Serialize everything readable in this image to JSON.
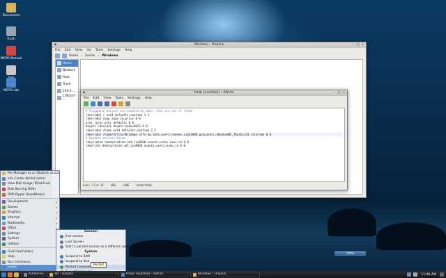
{
  "colors": {
    "accent": "#4a82c6",
    "highlight": "#5b8fd0",
    "taskbar": "#1c1f24"
  },
  "desktop": {
    "icons": [
      {
        "label": "Documents",
        "icon": "folder-icon",
        "color": "#d9b35a"
      },
      {
        "label": "Trash",
        "icon": "trash-icon",
        "color": "#9aa4ae"
      },
      {
        "label": "MEPIS Manual",
        "icon": "manual-icon",
        "color": "#d24a3f"
      },
      {
        "label": "Tiles",
        "icon": "tiles-icon",
        "color": "#c8c8c8"
      },
      {
        "label": "MEPIS site",
        "icon": "globe-icon",
        "color": "#4a86c9"
      }
    ]
  },
  "dolphin": {
    "title": "Windows – Dolphin",
    "menu": [
      "File",
      "Edit",
      "View",
      "Go",
      "Tools",
      "Settings",
      "Help"
    ],
    "breadcrumb": [
      "home",
      "Zerlas",
      "Windows"
    ],
    "places": [
      {
        "label": "Home",
        "selected": true
      },
      {
        "label": "Network",
        "selected": false
      },
      {
        "label": "Root",
        "selected": false
      },
      {
        "label": "Trash",
        "selected": false
      },
      {
        "label": "200.0 ...",
        "selected": false
      },
      {
        "label": "CTN/337 ...",
        "selected": false
      }
    ]
  },
  "kwrite": {
    "title": "fstab [modified] – KWrite",
    "menu": [
      "File",
      "Edit",
      "View",
      "Tools",
      "Settings",
      "Help"
    ],
    "lines": [
      {
        "text": "# Pluggable devices are handled by uDev, they are not in fstab",
        "kind": "comment"
      },
      {
        "text": "/dev/sdb2 / ext4 defaults,noatime 1 1",
        "kind": "entry"
      },
      {
        "text": "/dev/sdb3 swap swap sw,pri=1 0 0",
        "kind": "entry"
      },
      {
        "text": "proc /proc proc defaults 0 0",
        "kind": "entry"
      },
      {
        "text": "devpts /dev/pts devpts mode=0622 0 0",
        "kind": "entry"
      },
      {
        "text": "/dev/sdb3 /home ext4 defaults,noatime 1 2",
        "kind": "entry"
      },
      {
        "text": "/dev/sda1 /home/Zerlas/Windows ntfs-3g auto,users,noexec,uid=1000,gid=users,dmask=002,fmask=133,relatime 0 0",
        "kind": "entry",
        "current": true
      },
      {
        "text": "# Dynamic entries below",
        "kind": "comment"
      },
      {
        "text": "/dev/cdrom /media/cdrom udf,iso9660 noauto,users,exec,ro 0 0",
        "kind": "entry"
      },
      {
        "text": "/dev/sr0 /media/cdrom udf,iso9660 noauto,users,exec,ro 0 0",
        "kind": "entry"
      }
    ],
    "status": {
      "position": "Line: 7 Col: 31",
      "mode": "INS",
      "line_end": "LINE",
      "filename": "fstab fstab"
    }
  },
  "kmenu": {
    "top_items": [
      {
        "label": "File Manager as su (Dolphin as su)",
        "icon": "folder-icon",
        "color": "#d9b35a"
      },
      {
        "label": "Info Center (KInfoCenter)",
        "icon": "info-icon",
        "color": "#4a86c9"
      },
      {
        "label": "View Disk Usage (KDiskFree)",
        "icon": "disk-icon",
        "color": "#7a8aa0"
      },
      {
        "label": "Disk Burning (K3b)",
        "icon": "burn-icon",
        "color": "#c44"
      },
      {
        "label": "DVD Ripper (HandBrake)",
        "icon": "dvd-icon",
        "color": "#b86b2f"
      }
    ],
    "categories": [
      {
        "label": "Development",
        "icon": "dev-icon",
        "color": "#7c5aa6",
        "submenu": true
      },
      {
        "label": "Games",
        "icon": "games-icon",
        "color": "#59a13f",
        "submenu": true
      },
      {
        "label": "Graphics",
        "icon": "graphics-icon",
        "color": "#e0a030",
        "submenu": true
      },
      {
        "label": "Internet",
        "icon": "internet-icon",
        "color": "#3b7cc4",
        "submenu": true
      },
      {
        "label": "Multimedia",
        "icon": "multimedia-icon",
        "color": "#6aa0c8",
        "submenu": true
      },
      {
        "label": "Office",
        "icon": "office-icon",
        "color": "#c94c4c",
        "submenu": true
      },
      {
        "label": "Settings",
        "icon": "settings-icon",
        "color": "#7a8a99",
        "submenu": true
      },
      {
        "label": "System",
        "icon": "system-icon",
        "color": "#5a6470",
        "submenu": true
      },
      {
        "label": "Utilities",
        "icon": "utilities-icon",
        "color": "#3e8a6a",
        "submenu": true
      }
    ],
    "bottom_items": [
      {
        "label": "Find Files/Folders",
        "icon": "find-icon",
        "color": "#5a7fb0",
        "submenu": false
      },
      {
        "label": "Help",
        "icon": "help-icon",
        "color": "#d9cf55",
        "submenu": false
      },
      {
        "label": "Run Command...",
        "icon": "run-icon",
        "color": "#8a8a8a",
        "submenu": false
      },
      {
        "label": "Leave",
        "icon": "leave-icon",
        "color": "#4a86c9",
        "submenu": true,
        "highlighted": true
      }
    ]
  },
  "leave": {
    "session_header": "Session",
    "session_items": [
      {
        "label": "End session",
        "icon": "logout-icon",
        "color": "#3f78c0"
      },
      {
        "label": "Lock Screen",
        "icon": "lock-icon",
        "color": "#6a7a8a"
      },
      {
        "label": "Start a parallel session as a different user",
        "icon": "switch-user-icon",
        "color": "#8a6fc0"
      }
    ],
    "system_header": "System",
    "system_items": [
      {
        "label": "Suspend to RAM",
        "icon": "suspend-ram-icon",
        "color": "#3f78c0",
        "highlighted": false
      },
      {
        "label": "Suspend to disk",
        "icon": "suspend-disk-icon",
        "color": "#3f78c0",
        "highlighted": false
      },
      {
        "label": "Restart computer",
        "icon": "restart-icon",
        "color": "#3a9a4a",
        "highlighted": true
      },
      {
        "label": "Turn off computer",
        "icon": "shutdown-icon",
        "color": "#c43c3c",
        "highlighted": false
      }
    ],
    "tooltip": "Restart"
  },
  "volume": {
    "label": "100%",
    "level": 1.0
  },
  "taskbar": {
    "tasks": [
      {
        "label": "KDiskFree",
        "icon": "disk-icon",
        "color": "#7a8aa0"
      },
      {
        "label": "etc - Dolphin",
        "icon": "folder-icon",
        "color": "#d9b35a"
      },
      {
        "label": "fstab [modified] – KWrite",
        "icon": "kwrite-icon",
        "color": "#4a86c9"
      },
      {
        "label": "Windows – Dolphin",
        "icon": "folder-icon",
        "color": "#d9b35a"
      }
    ],
    "clock": "11:46 AM"
  }
}
